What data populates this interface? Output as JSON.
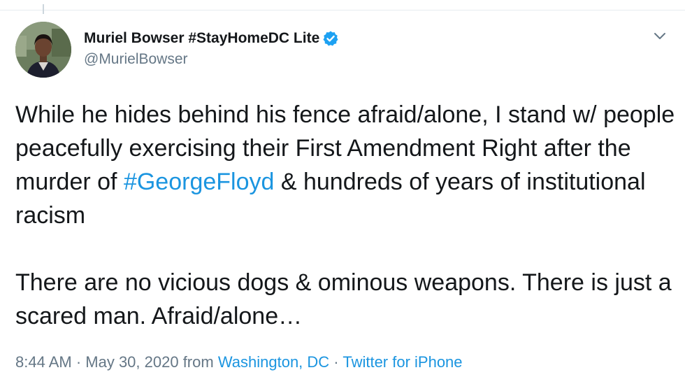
{
  "tweet": {
    "author": {
      "display_name": "Muriel Bowser #StayHomeDC Lite",
      "handle": "@MurielBowser",
      "verified_icon": "verified-badge-icon"
    },
    "menu_icon": "chevron-down-icon",
    "body": {
      "para1_before": "While he hides behind his fence afraid/alone, I stand w/ people peacefully exercising their First Amendment Right after the murder of ",
      "hashtag": "#GeorgeFloyd",
      "para1_after": " & hundreds of years of institutional racism",
      "para2": "There are no vicious dogs & ominous weapons. There is just a scared man. Afraid/alone…"
    },
    "meta": {
      "timestamp": "8:44 AM · May 30, 2020 from ",
      "location": "Washington, DC",
      "separator": " · ",
      "source": "Twitter for iPhone"
    }
  },
  "colors": {
    "text": "#14171a",
    "secondary": "#657786",
    "link": "#1b95e0",
    "verified": "#1da1f2"
  }
}
